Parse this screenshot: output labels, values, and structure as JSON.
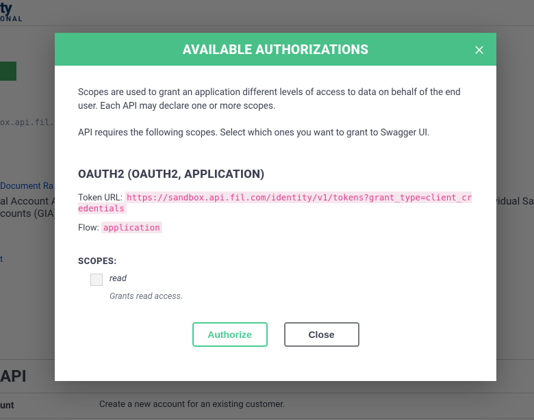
{
  "background": {
    "brand_line1": "ty",
    "brand_line2": "ONAL",
    "path_snippet": "ox.api.fil.c",
    "link_doc": "Document Ra",
    "account_line1": "al Account A",
    "account_line2": "counts (GIA)",
    "link_t": "t",
    "right_text": "vidual Sa",
    "api_heading": "API",
    "row_badge": "unt",
    "row_desc": "Create a new account for an existing customer."
  },
  "modal": {
    "title": "AVAILABLE AUTHORIZATIONS",
    "intro1": "Scopes are used to grant an application different levels of access to data on behalf of the end user. Each API may declare one or more scopes.",
    "intro2": "API requires the following scopes. Select which ones you want to grant to Swagger UI.",
    "oauth_title": "OAUTH2 (OAUTH2, APPLICATION)",
    "token_label": "Token URL: ",
    "token_url": "https://sandbox.api.fil.com/identity/v1/tokens?grant_type=client_credentials",
    "flow_label": "Flow: ",
    "flow_value": "application",
    "scopes_label": "SCOPES:",
    "scope_read_name": "read",
    "scope_read_desc": "Grants read access.",
    "authorize_btn": "Authorize",
    "close_btn": "Close"
  }
}
